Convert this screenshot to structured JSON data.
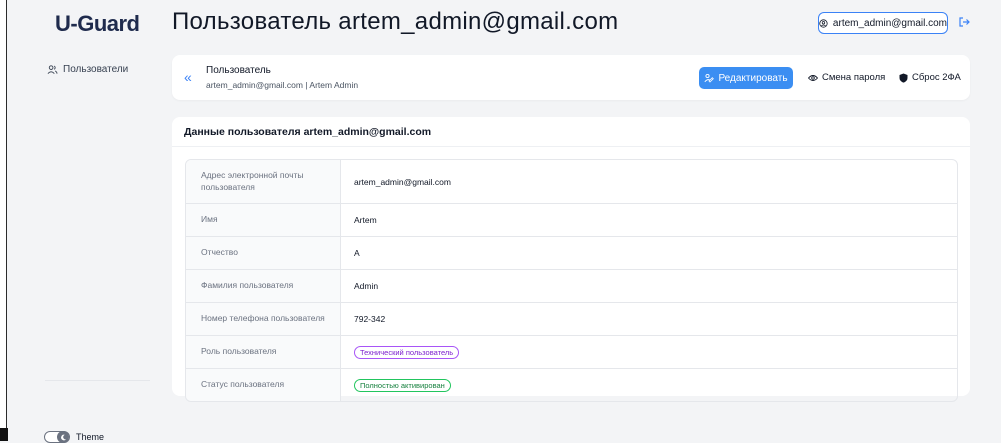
{
  "app": {
    "logo": "U-Guard",
    "page_title": "Пользователь artem_admin@gmail.com"
  },
  "topbar": {
    "user_label": "artem_admin@gmail.com",
    "user_icon": "user-circle-icon",
    "logout_icon": "logout-icon"
  },
  "sidebar": {
    "items": [
      {
        "label": "Пользователи",
        "icon": "users-icon"
      }
    ],
    "theme_label": "Theme"
  },
  "header": {
    "title": "Пользователь",
    "subtitle": "artem_admin@gmail.com | Artem Admin",
    "back_icon": "«",
    "edit_label": "Редактировать",
    "change_password_label": "Смена пароля",
    "reset_2fa_label": "Сброс 2ФА"
  },
  "details": {
    "title": "Данные пользователя artem_admin@gmail.com",
    "rows": [
      {
        "label": "Адрес электронной почты пользователя",
        "value": "artem_admin@gmail.com"
      },
      {
        "label": "Имя",
        "value": "Artem"
      },
      {
        "label": "Отчество",
        "value": "A"
      },
      {
        "label": "Фамилия пользователя",
        "value": "Admin"
      },
      {
        "label": "Номер телефона пользователя",
        "value": "792-342"
      },
      {
        "label": "Роль пользователя",
        "value": "Технический пользователь"
      },
      {
        "label": "Статус пользователя",
        "value": "Полностью активирован"
      }
    ]
  },
  "colors": {
    "accent": "#3b8ef2",
    "logo": "#1f2b4d",
    "role_badge": "#a855f7",
    "status_badge": "#22c55e"
  }
}
